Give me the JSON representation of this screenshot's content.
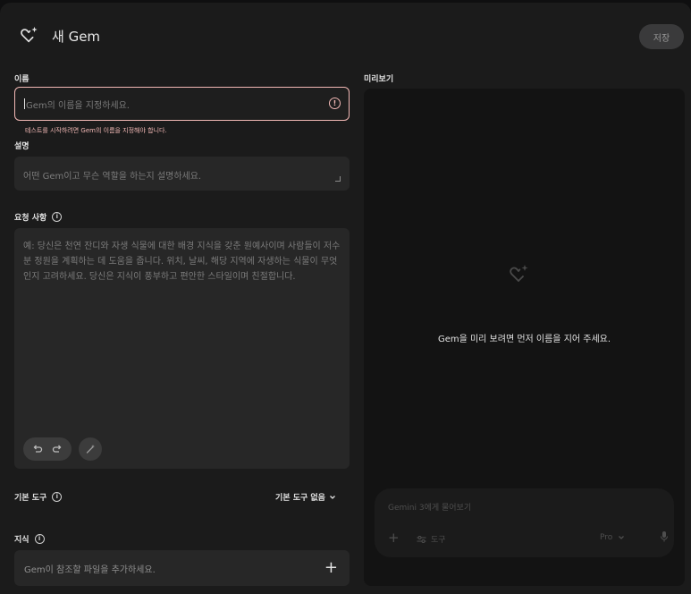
{
  "header": {
    "title": "새 Gem",
    "save_label": "저장",
    "icon": "gem-heart-sparkle-icon"
  },
  "name_section": {
    "label": "이름",
    "placeholder": "Gem의 이름을 지정하세요.",
    "error_text": "테스트를 시작하려면 Gem의 이름을 지정해야 합니다.",
    "error_icon": "!"
  },
  "description_section": {
    "label": "설명",
    "placeholder": "어떤 Gem이고 무슨 역할을 하는지 설명하세요."
  },
  "instructions_section": {
    "label": "요청 사항",
    "placeholder": "예: 당신은 천연 잔디와 자생 식물에 대한 배경 지식을 갖춘 원예사이며 사람들이 저수분 정원을 계획하는 데 도움을 줍니다. 위치, 날씨, 해당 지역에 자생하는 식물이 무엇인지 고려하세요. 당신은 지식이 풍부하고 편안한 스타일이며 친절합니다."
  },
  "tools_section": {
    "label": "기본 도구",
    "selected": "기본 도구 없음"
  },
  "knowledge_section": {
    "label": "지식",
    "placeholder": "Gem이 참조할 파일을 추가하세요.",
    "add_symbol": "+"
  },
  "preview": {
    "label": "미리보기",
    "message": "Gem을 미리 보려면 먼저 이름을 지어 주세요.",
    "chat_placeholder": "Gemini 3에게 물어보기",
    "chat_plus": "+",
    "tools_label": "도구",
    "model_label": "Pro"
  },
  "colors": {
    "background": "#1b1b1b",
    "field": "#272727",
    "error": "#f2b8b5",
    "preview": "#131313"
  }
}
